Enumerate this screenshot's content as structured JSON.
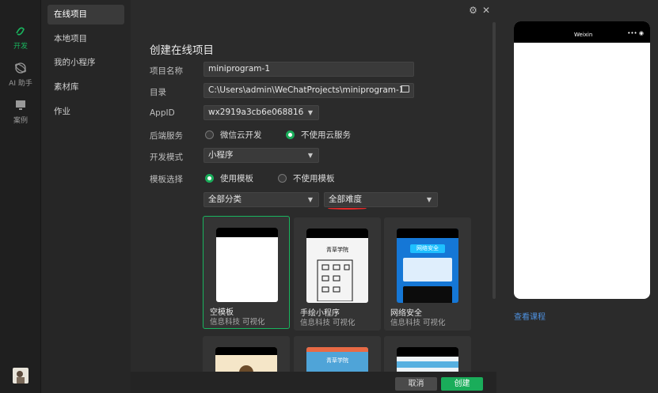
{
  "rail": {
    "items": [
      {
        "label": "开发",
        "icon": "code-icon"
      },
      {
        "label": "AI 助手",
        "icon": "ai-icon"
      },
      {
        "label": "案例",
        "icon": "monitor-icon"
      }
    ]
  },
  "menu": {
    "items": [
      "在线项目",
      "本地项目",
      "我的小程序",
      "素材库",
      "作业"
    ]
  },
  "form": {
    "title": "创建在线项目",
    "name_label": "项目名称",
    "name_value": "miniprogram-1",
    "dir_label": "目录",
    "dir_value": "C:\\Users\\admin\\WeChatProjects\\miniprogram-1",
    "appid_label": "AppID",
    "appid_value": "wx2919a3cb6e068816",
    "backend_label": "后端服务",
    "backend_opt1": "微信云开发",
    "backend_opt2": "不使用云服务",
    "mode_label": "开发模式",
    "mode_value": "小程序",
    "template_label": "模板选择",
    "template_opt1": "使用模板",
    "template_opt2": "不使用模板",
    "category_value": "全部分类",
    "difficulty_value": "全部难度"
  },
  "templates": [
    {
      "name": "空模板",
      "sub": "信息科技 可视化"
    },
    {
      "name": "手绘小程序",
      "sub": "信息科技 可视化",
      "thumb_text": "青草学院"
    },
    {
      "name": "网络安全",
      "sub": "信息科技 可视化",
      "thumb_text": "网络安全"
    }
  ],
  "bottom_templates": [
    {
      "thumb_text": ""
    },
    {
      "thumb_text": "青草学院"
    },
    {
      "thumb_text": ""
    }
  ],
  "footer": {
    "cancel": "取消",
    "create": "创建"
  },
  "preview": {
    "phone_title": "Weixin",
    "link": "查看课程"
  }
}
